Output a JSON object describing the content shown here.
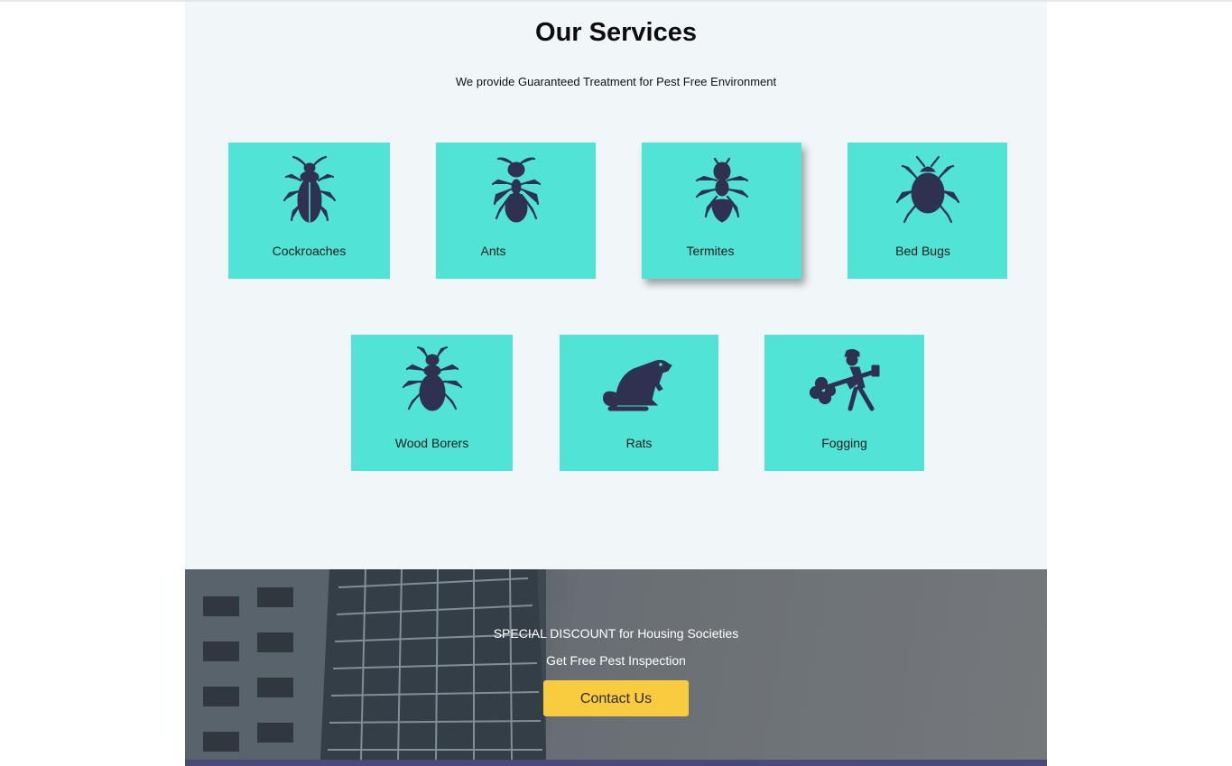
{
  "services": {
    "title": "Our Services",
    "subtitle": "We provide Guaranteed Treatment for Pest Free Environment",
    "cards": [
      {
        "label": "Cockroaches",
        "icon": "cockroach-icon"
      },
      {
        "label": "Ants",
        "icon": "ant-icon"
      },
      {
        "label": "Termites",
        "icon": "termite-icon"
      },
      {
        "label": "Bed Bugs",
        "icon": "bed-bug-icon"
      },
      {
        "label": "Wood Borers",
        "icon": "wood-borer-icon"
      },
      {
        "label": "Rats",
        "icon": "rat-icon"
      },
      {
        "label": "Fogging",
        "icon": "fogging-icon"
      }
    ]
  },
  "banner": {
    "line1": "SPECIAL DISCOUNT for Housing Societies",
    "line2": "Get Free Pest Inspection",
    "cta_label": "Contact Us"
  },
  "colors": {
    "card": "#52e3d7",
    "icon": "#2f3150",
    "cta": "#f9cb3e",
    "section_bg": "#f1f6f9"
  }
}
